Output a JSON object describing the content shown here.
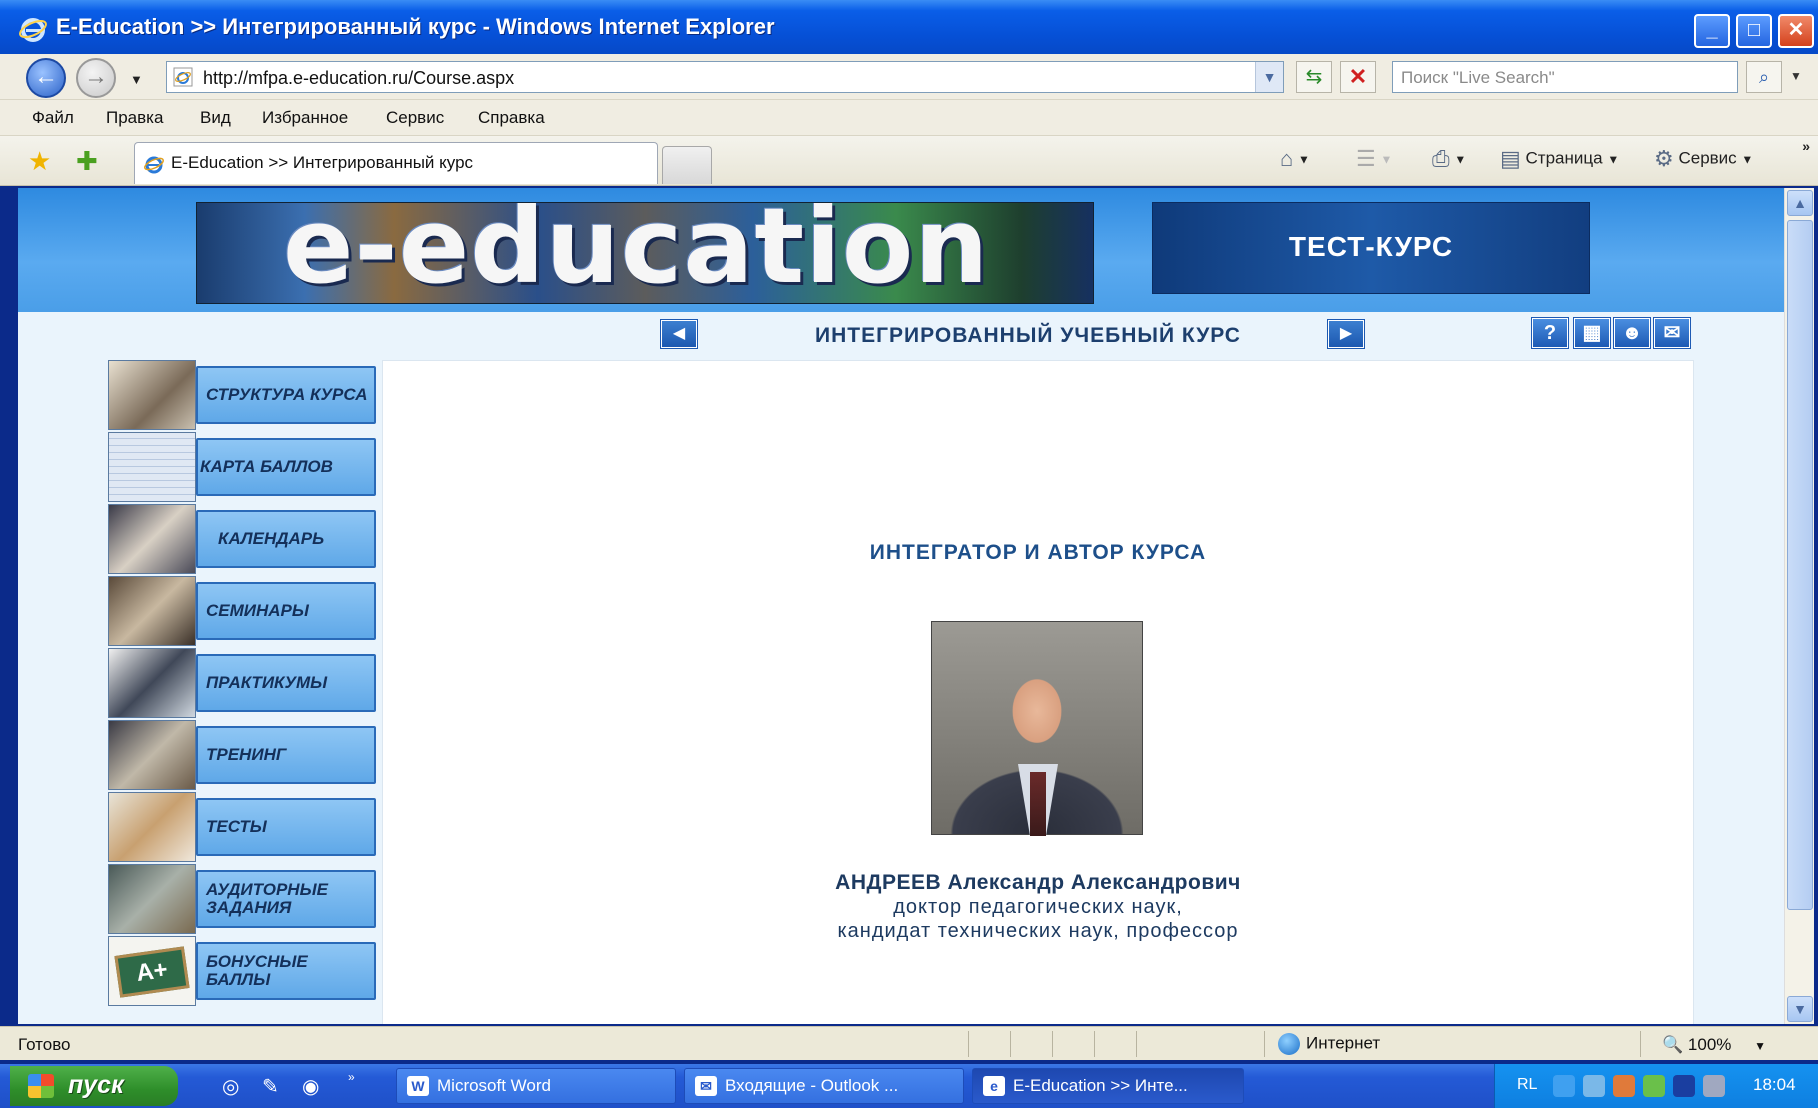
{
  "window": {
    "title": "E-Education >> Интегрированный курс - Windows Internet Explorer",
    "min": "_",
    "max": "□",
    "close": "✕"
  },
  "address": {
    "url": "http://mfpa.e-education.ru/Course.aspx",
    "search_placeholder": "Поиск \"Live Search\""
  },
  "menu": [
    "Файл",
    "Правка",
    "Вид",
    "Избранное",
    "Сервис",
    "Справка"
  ],
  "tab": {
    "label": "E-Education >> Интегрированный курс"
  },
  "toolbar": {
    "page_label": "Страница",
    "tools_label": "Сервис",
    "more": "»"
  },
  "site": {
    "logo_text": "e-education",
    "badge": "ТЕСТ-КУРС",
    "course_title": "ИНТЕГРИРОВАННЫЙ УЧЕБНЫЙ КУРС",
    "sidebar": [
      "СТРУКТУРА КУРСА",
      "КАРТА БАЛЛОВ",
      "КАЛЕНДАРЬ",
      "СЕМИНАРЫ",
      "ПРАКТИКУМЫ",
      "ТРЕНИНГ",
      "ТЕСТЫ",
      "АУДИТОРНЫЕ ЗАДАНИЯ",
      "БОНУСНЫЕ БАЛЛЫ"
    ],
    "heading": "ИНТЕГРАТОР И АВТОР КУРСА",
    "author_name": "АНДРЕЕВ Александр Александрович",
    "author_line1": "доктор педагогических наук,",
    "author_line2": "кандидат технических наук, профессор"
  },
  "status": {
    "text": "Готово",
    "zone": "Интернет",
    "zoom": "100%"
  },
  "taskbar": {
    "start": "пуск",
    "buttons": [
      "Microsoft Word",
      "Входящие - Outlook ...",
      "E-Education >> Инте..."
    ],
    "lang": "RL",
    "time": "18:04"
  }
}
